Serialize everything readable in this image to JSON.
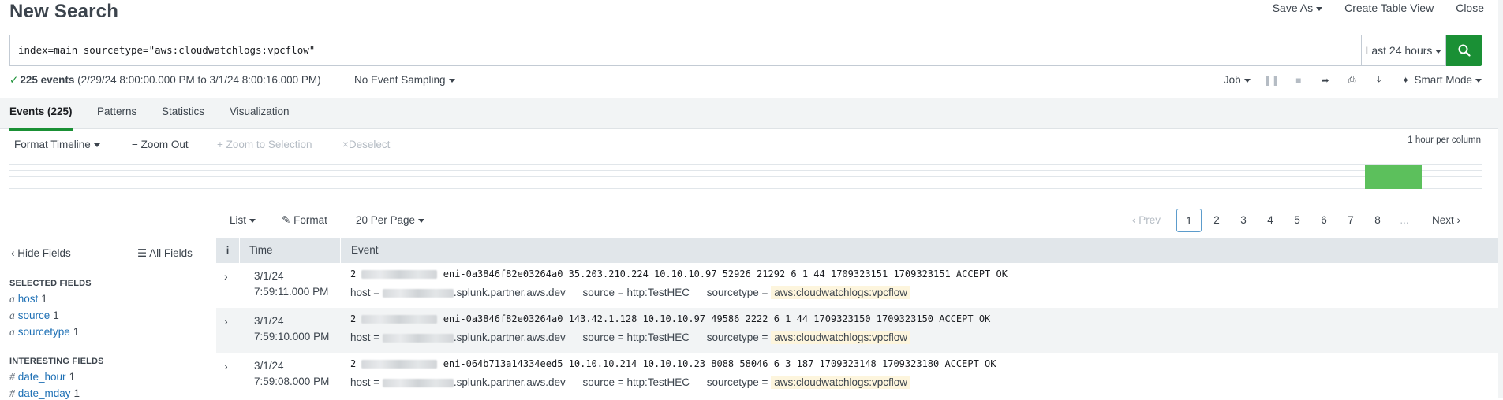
{
  "header": {
    "title": "New Search",
    "actions": {
      "save_as": "Save As",
      "create_table_view": "Create Table View",
      "close": "Close"
    }
  },
  "search": {
    "query": "index=main sourcetype=\"aws:cloudwatchlogs:vpcflow\"",
    "time_range": "Last 24 hours",
    "go_icon": "search-icon",
    "go_color": "#1a9035"
  },
  "status": {
    "count": "225 events",
    "range": "(2/29/24 8:00:00.000 PM to 3/1/24 8:00:16.000 PM)",
    "sampling": "No Event Sampling",
    "job": "Job",
    "mode": "Smart Mode"
  },
  "tabs": [
    "Events (225)",
    "Patterns",
    "Statistics",
    "Visualization"
  ],
  "timeline": {
    "format": "Format Timeline",
    "zoom_out": "Zoom Out",
    "zoom_selection": "Zoom to Selection",
    "deselect": "Deselect",
    "per_column": "1 hour per column",
    "bar_color": "#5cc05c"
  },
  "results_bar": {
    "view": "List",
    "format": "Format",
    "per_page": "20 Per Page",
    "prev": "Prev",
    "pages": [
      "1",
      "2",
      "3",
      "4",
      "5",
      "6",
      "7",
      "8"
    ],
    "ellipsis": "...",
    "next": "Next"
  },
  "sidebar": {
    "hide_fields": "Hide Fields",
    "all_fields": "All Fields",
    "selected_heading": "SELECTED FIELDS",
    "selected": [
      {
        "type": "a",
        "name": "host",
        "count": "1"
      },
      {
        "type": "a",
        "name": "source",
        "count": "1"
      },
      {
        "type": "a",
        "name": "sourcetype",
        "count": "1"
      }
    ],
    "interesting_heading": "INTERESTING FIELDS",
    "interesting": [
      {
        "type": "#",
        "name": "date_hour",
        "count": "1"
      },
      {
        "type": "#",
        "name": "date_mday",
        "count": "1"
      }
    ]
  },
  "events_table": {
    "col_info": "i",
    "col_time": "Time",
    "col_event": "Event",
    "rows": [
      {
        "date": "3/1/24",
        "time": "7:59:11.000 PM",
        "raw_prefix": "2",
        "raw": "eni-0a3846f82e03264a0 35.203.210.224 10.10.10.97 52926 21292 6 1 44 1709323151 1709323151 ACCEPT OK",
        "host_suffix": ".splunk.partner.aws.dev",
        "source": "http:TestHEC",
        "sourcetype": "aws:cloudwatchlogs:vpcflow"
      },
      {
        "date": "3/1/24",
        "time": "7:59:10.000 PM",
        "raw_prefix": "2",
        "raw": "eni-0a3846f82e03264a0 143.42.1.128 10.10.10.97 49586 2222 6 1 44 1709323150 1709323150 ACCEPT OK",
        "host_suffix": ".splunk.partner.aws.dev",
        "source": "http:TestHEC",
        "sourcetype": "aws:cloudwatchlogs:vpcflow"
      },
      {
        "date": "3/1/24",
        "time": "7:59:08.000 PM",
        "raw_prefix": "2",
        "raw": "eni-064b713a14334eed5 10.10.10.214 10.10.10.23 8088 58046 6 3 187 1709323148 1709323180 ACCEPT OK",
        "host_suffix": ".splunk.partner.aws.dev",
        "source": "http:TestHEC",
        "sourcetype": "aws:cloudwatchlogs:vpcflow"
      }
    ],
    "labels": {
      "host": "host =",
      "source": "source =",
      "sourcetype": "sourcetype ="
    }
  }
}
